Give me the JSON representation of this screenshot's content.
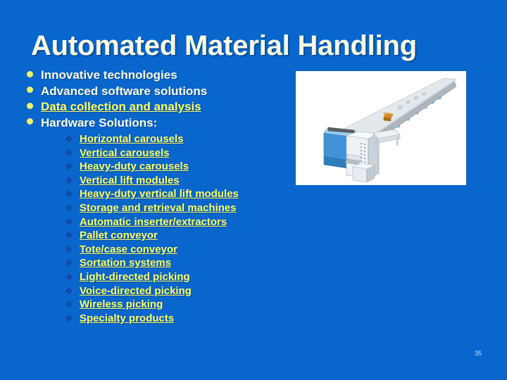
{
  "slide": {
    "title": "Automated Material Handling",
    "page_number": "35",
    "background_color": "#0866cc",
    "title_color": "#fdfbe2",
    "link_color": "#ffff66",
    "body_text_color": "#fdfbe2"
  },
  "bullets": [
    {
      "text": "Innovative technologies",
      "marker": "disc-bullet",
      "link": false
    },
    {
      "text": "Advanced software solutions",
      "marker": "disc-bullet",
      "link": false
    },
    {
      "text": "Data collection and analysis",
      "marker": "disc-bullet",
      "link": true
    },
    {
      "text": "Hardware Solutions:",
      "marker": "disc-bullet",
      "link": false
    }
  ],
  "sub_bullets": [
    {
      "text": "Horizontal carousels",
      "marker": "diamond-bullet",
      "link": true
    },
    {
      "text": "Vertical carousels",
      "marker": "diamond-bullet",
      "link": true
    },
    {
      "text": "Heavy-duty carousels",
      "marker": "diamond-bullet",
      "link": true
    },
    {
      "text": "Vertical lift modules",
      "marker": "diamond-bullet",
      "link": true
    },
    {
      "text": "Heavy-duty vertical lift modules",
      "marker": "diamond-bullet",
      "link": true
    },
    {
      "text": "Storage and retrieval machines",
      "marker": "diamond-bullet",
      "link": true
    },
    {
      "text": "Automatic inserter/extractors",
      "marker": "diamond-bullet",
      "link": true
    },
    {
      "text": "Pallet conveyor",
      "marker": "diamond-bullet",
      "link": true
    },
    {
      "text": "Tote/case conveyor",
      "marker": "diamond-bullet",
      "link": true
    },
    {
      "text": "Sortation systems",
      "marker": "diamond-bullet",
      "link": true
    },
    {
      "text": "Light-directed picking",
      "marker": "diamond-bullet",
      "link": true
    },
    {
      "text": "Voice-directed picking",
      "marker": "diamond-bullet",
      "link": true
    },
    {
      "text": "Wireless picking",
      "marker": "diamond-bullet",
      "link": true
    },
    {
      "text": "Specialty products",
      "marker": "diamond-bullet",
      "link": true
    }
  ],
  "picture": {
    "name": "sortation-conveyor-illustration",
    "description": "Blue 3D illustration of an automated sortation conveyor line with chutes and a control cabinet",
    "background_color": "#ffffff"
  },
  "markers": {
    "disc_glyph": "●",
    "diamond_glyph": "❖"
  }
}
